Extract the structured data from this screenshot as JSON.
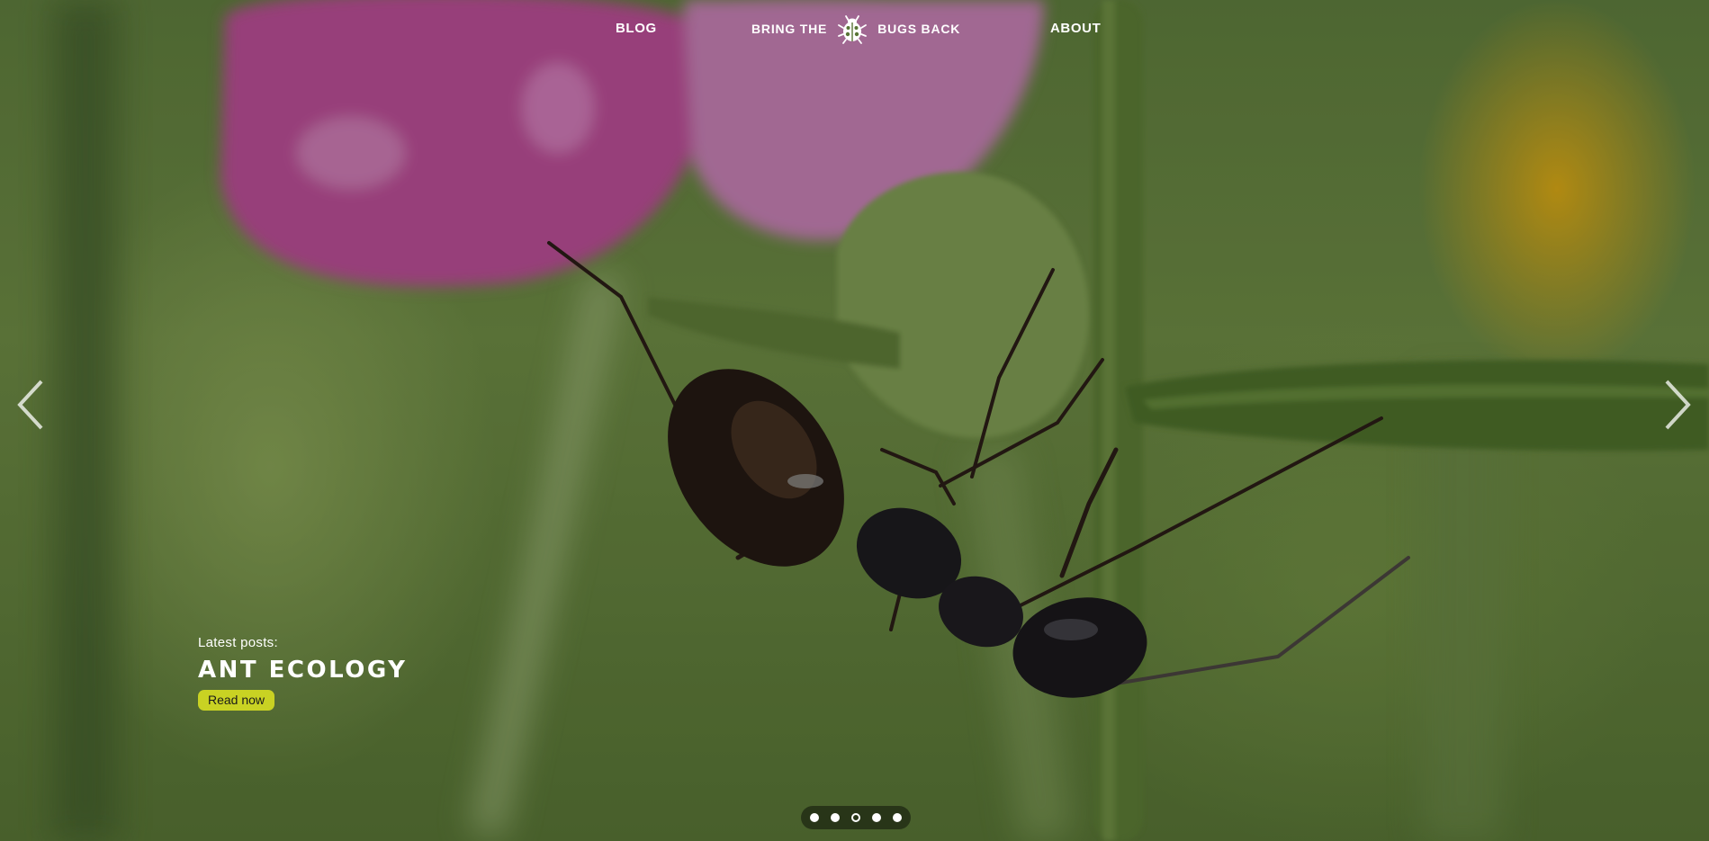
{
  "nav": {
    "blog_label": "BLOG",
    "brand_left": "BRING THE",
    "brand_right": "BUGS BACK",
    "about_label": "ABOUT",
    "logo_icon": "ladybug-icon"
  },
  "carousel": {
    "prev_icon": "chevron-left-icon",
    "next_icon": "chevron-right-icon",
    "slide_count": 5,
    "active_index": 2,
    "caption": {
      "eyebrow": "Latest posts:",
      "title": "ANT ECOLOGY",
      "button_label": "Read now"
    }
  },
  "colors": {
    "accent": "#c9d223",
    "text": "#ffffff"
  }
}
